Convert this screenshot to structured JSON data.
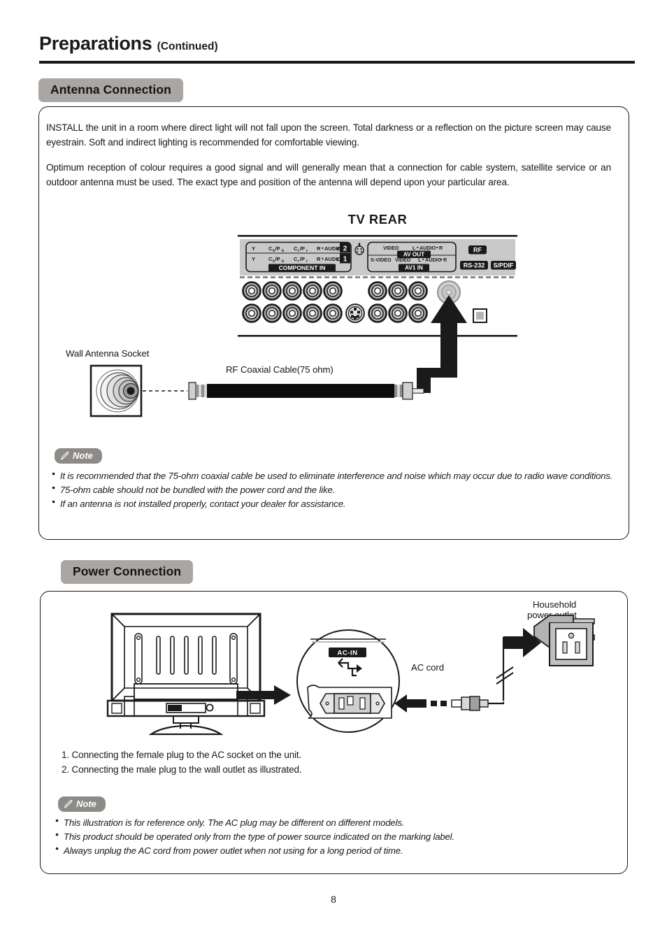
{
  "page": {
    "title": "Preparations",
    "title_suffix": "(Continued)",
    "number": "8"
  },
  "sections": {
    "antenna": {
      "heading": "Antenna Connection",
      "paragraphs": [
        "INSTALL the unit in a room where direct light will not fall upon the screen. Total darkness or a reflection on the picture screen may cause eyestrain. Soft and indirect lighting is recommended for comfortable viewing.",
        "Optimum reception of colour requires a good signal and will generally mean that a connection for cable system, satellite service or an outdoor antenna must be used. The exact type and position of the antenna will depend upon your particular area."
      ],
      "diagram": {
        "tv_rear_label": "TV REAR",
        "wall_socket_label": "Wall Antenna Socket",
        "coax_label": "RF Coaxial Cable(75 ohm)",
        "panel_labels": {
          "component_row_top": [
            "Y",
            "Cb/Pb",
            "Cr/Pr",
            "R•AUDIO•L"
          ],
          "component_row_bottom": [
            "Y",
            "Cb/Pb",
            "Cr/Pr",
            "R•AUDIO•L"
          ],
          "component_index_top": "2",
          "component_index_bottom": "1",
          "component_in": "COMPONENT IN",
          "av_out_video": "VIDEO",
          "av_out_audio": "L•AUDIO•R",
          "av_out": "AV OUT",
          "s_video": "S-VIDEO",
          "av1_in_video": "VIDEO",
          "av1_in_audio": "L•AUDIO•R",
          "av1_in": "AV1 IN",
          "rf": "RF",
          "rs232": "RS-232",
          "spdif": "S/PDIF"
        }
      },
      "note": {
        "label": "Note",
        "items": [
          "It is recommended that the 75-ohm coaxial cable be used to eliminate interference and noise which may occur due to radio wave conditions.",
          "75-ohm cable should not be bundled with the power cord and the like.",
          "If an antenna is not installed properly, contact your dealer for assistance."
        ]
      }
    },
    "power": {
      "heading": "Power Connection",
      "diagram": {
        "household_outlet_label_line1": "Household",
        "household_outlet_label_line2": "power outlet",
        "ac_cord_label": "AC cord",
        "ac_in_label": "AC-IN"
      },
      "steps": [
        "1. Connecting the female plug to the AC socket on the unit.",
        "2. Connecting the male plug to the wall outlet as illustrated."
      ],
      "note": {
        "label": "Note",
        "items": [
          "This illustration is for reference only.  The AC plug may be different on different models.",
          "This product should be operated only from the type of power source indicated on the marking label.",
          "Always unplug the AC cord from power outlet when not using for a long period of time."
        ]
      }
    }
  },
  "colors": {
    "pill_gray": "#a9a6a3",
    "note_pill_gray": "#8d8b88",
    "panel_gray": "#c9c9c9",
    "jack_gray": "#bfbfbf",
    "ink": "#1a1a1a"
  }
}
